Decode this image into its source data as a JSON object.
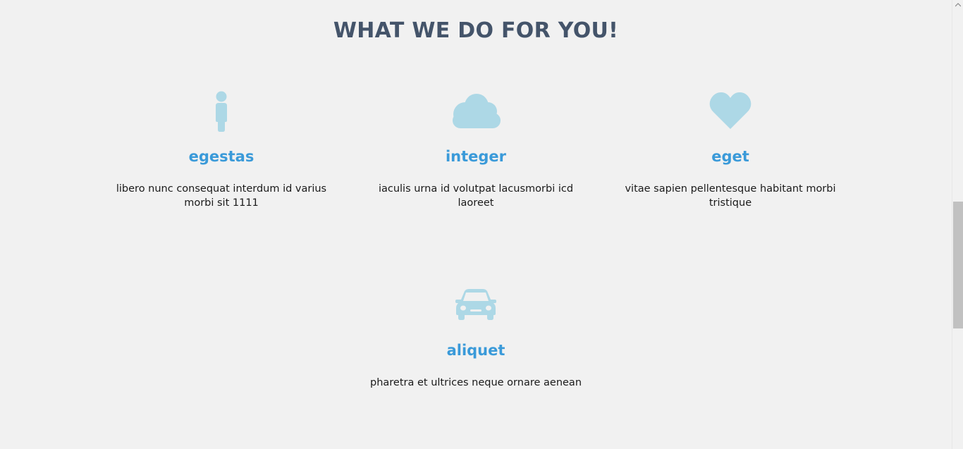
{
  "section": {
    "title": "WHAT WE DO FOR YOU!"
  },
  "services": [
    {
      "icon": "person-icon",
      "title": "egestas",
      "description": "libero nunc consequat interdum id varius morbi sit 1111"
    },
    {
      "icon": "cloud-icon",
      "title": "integer",
      "description": "iaculis urna id volutpat lacusmorbi icd laoreet"
    },
    {
      "icon": "heart-icon",
      "title": "eget",
      "description": "vitae sapien pellentesque habitant morbi tristique"
    },
    {
      "icon": "car-icon",
      "title": "aliquet",
      "description": "pharetra et ultrices neque ornare aenean"
    }
  ],
  "colors": {
    "background": "#f1f1f1",
    "heading": "#44546a",
    "service_title": "#3a9ad9",
    "icon": "#add8e6",
    "text": "#1a1a1a"
  },
  "scrollbar": {
    "position": 0.5
  }
}
